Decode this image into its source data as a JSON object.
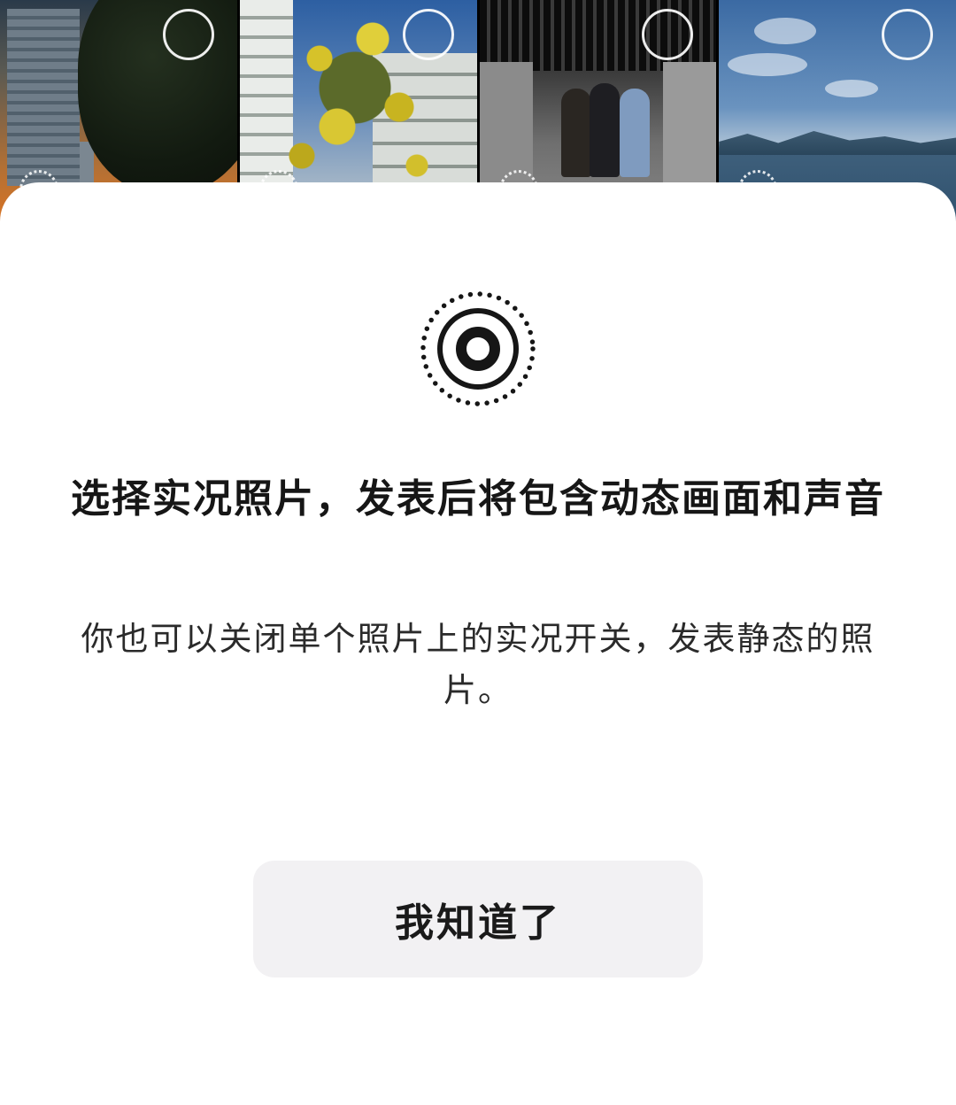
{
  "photo_grid": {
    "photos": [
      {
        "label": "photo-sunset-tower",
        "selected": false,
        "live": true
      },
      {
        "label": "photo-yellow-tree",
        "selected": false,
        "live": true
      },
      {
        "label": "photo-hallway-group",
        "selected": false,
        "live": true
      },
      {
        "label": "photo-seaside",
        "selected": false,
        "live": true
      }
    ]
  },
  "live_photo_sheet": {
    "icon": "live-photo-icon",
    "title": "选择实况照片，发表后将包含动态画面和声音",
    "subtitle": "你也可以关闭单个照片上的实况开关，发表静态的照片。",
    "confirm_label": "我知道了"
  },
  "colors": {
    "sheet_background": "#ffffff",
    "button_background": "#f2f1f3",
    "text_primary": "#161616",
    "text_secondary": "#2a2a2a"
  }
}
